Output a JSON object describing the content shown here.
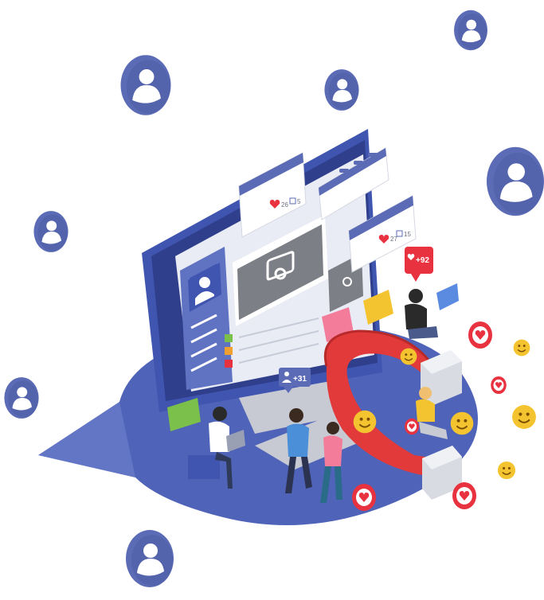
{
  "illustration": {
    "like_badge_count": "+92",
    "follower_badge_count": "+31",
    "post_card_left": {
      "likes": "26",
      "comments": "5"
    },
    "post_card_right": {
      "likes": "27",
      "comments": "15"
    }
  },
  "colors": {
    "avatar_blue": "#5b6bb5",
    "avatar_face": "#ffffff",
    "platform_blue": "#4f63b8",
    "screen_blue": "#3f55b0",
    "magnet_red": "#e23a3a",
    "magnet_silver": "#d9dbe2",
    "emoji_yellow": "#f4c430",
    "heart_red": "#e8323f"
  },
  "icons": [
    "user-avatar-icon",
    "camera-icon",
    "heart-icon",
    "comment-icon",
    "add-user-icon",
    "smiley-icon",
    "magnet-icon",
    "chat-bubble-icon"
  ]
}
